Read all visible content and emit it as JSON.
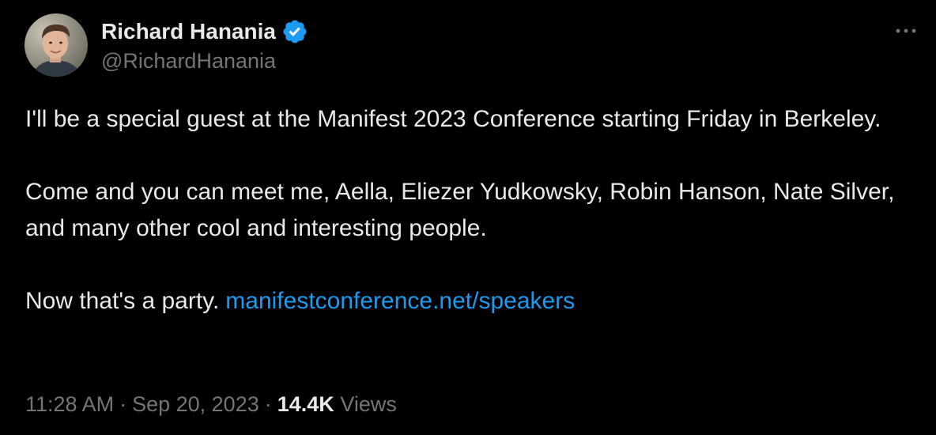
{
  "author": {
    "display_name": "Richard Hanania",
    "handle": "@RichardHanania",
    "verified": true,
    "avatar_icon": "profile-photo"
  },
  "menu": {
    "icon": "more-horizontal-icon"
  },
  "tweet": {
    "paragraphs": [
      "I'll be a special guest at the Manifest 2023 Conference starting Friday in Berkeley.",
      "Come and you can meet me, Aella, Eliezer Yudkowsky, Robin Hanson, Nate Silver, and many other cool and interesting people."
    ],
    "last_paragraph_text": "Now that's a party.",
    "link_text": "manifestconference.net/speakers"
  },
  "meta": {
    "time": "11:28 AM",
    "separator": "·",
    "date": "Sep 20, 2023",
    "views_count": "14.4K",
    "views_label": "Views"
  },
  "colors": {
    "background": "#000000",
    "primary_text": "#e7e9ea",
    "secondary_text": "#71767b",
    "link": "#1d9bf0",
    "verified_badge": "#1d9bf0"
  }
}
